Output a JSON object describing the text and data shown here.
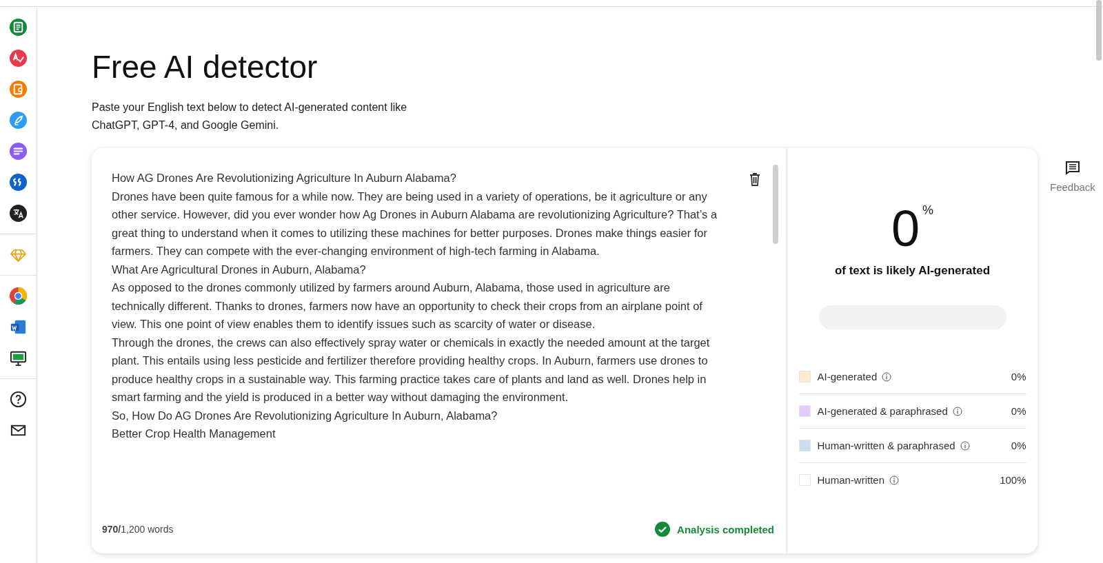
{
  "page": {
    "title": "Free AI detector",
    "subtitle_lines": [
      "Paste your English text below to detect AI-generated content like",
      "ChatGPT, GPT-4, and Google Gemini."
    ]
  },
  "editor": {
    "paragraphs": [
      "How AG Drones Are Revolutionizing Agriculture In Auburn Alabama?",
      "Drones have been quite famous for a while now. They are being used in a variety of operations, be it agriculture or any other service. However, did you ever wonder how Ag Drones in Auburn Alabama are revolutionizing Agriculture? That’s a great thing to understand when it comes to utilizing these machines for better purposes. Drones make things easier for farmers. They can compete with the ever-changing environment of high-tech farming in Alabama.",
      "What Are Agricultural Drones in Auburn, Alabama?",
      "As opposed to the drones commonly utilized by farmers around Auburn, Alabama, those used in agriculture are technically different. Thanks to drones, farmers now have an opportunity to check their crops from an airplane point of view. This one point of view enables them to identify issues such as scarcity of water or disease.",
      "Through the drones, the crews can also effectively spray water or chemicals in exactly the needed amount at the target plant. This entails using less pesticide and fertilizer therefore providing healthy crops. In Auburn, farmers use drones to produce healthy crops in a sustainable way. This farming practice takes care of plants and land as well. Drones help in smart farming and the yield is produced in a better way without damaging the environment.",
      "So, How Do AG Drones Are Revolutionizing Agriculture In Auburn, Alabama?",
      "Better Crop Health Management"
    ],
    "word_count": "**970/**1,200 words",
    "status": "Analysis completed"
  },
  "result": {
    "percent": "0",
    "percent_sign": "%",
    "caption": "of text is likely AI-generated",
    "legend": [
      {
        "label": "AI-generated",
        "value": "0%",
        "color": "#fdeccc"
      },
      {
        "label": "AI-generated & paraphrased",
        "value": "0%",
        "color": "#e3ccfb"
      },
      {
        "label": "Human-written & paraphrased",
        "value": "0%",
        "color": "#ccdcf3"
      },
      {
        "label": "Human-written",
        "value": "100%",
        "color": "#ffffff"
      }
    ]
  },
  "feedback": {
    "label": "Feedback"
  }
}
